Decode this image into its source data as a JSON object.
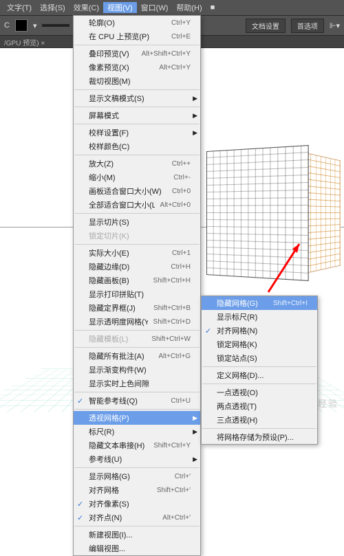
{
  "menubar": {
    "items": [
      "文字(T)",
      "选择(S)",
      "效果(C)",
      "视图(V)",
      "窗口(W)",
      "帮助(H)",
      "■"
    ]
  },
  "toolbar": {
    "doc_label": "文档设置",
    "pref_label": "首选项"
  },
  "subbar": {
    "text": "/GPU 预览)  ×"
  },
  "menu": {
    "g1": [
      {
        "l": "轮廓(O)",
        "s": "Ctrl+Y"
      },
      {
        "l": "在 CPU 上预览(P)",
        "s": "Ctrl+E"
      }
    ],
    "g2": [
      {
        "l": "叠印预览(V)",
        "s": "Alt+Shift+Ctrl+Y"
      },
      {
        "l": "像素预览(X)",
        "s": "Alt+Ctrl+Y"
      },
      {
        "l": "裁切视图(M)"
      }
    ],
    "g3": [
      {
        "l": "显示文稿模式(S)",
        "sub": true
      }
    ],
    "g4": [
      {
        "l": "屏幕模式",
        "sub": true
      }
    ],
    "g5": [
      {
        "l": "校样设置(F)",
        "sub": true
      },
      {
        "l": "校样颜色(C)"
      }
    ],
    "g6": [
      {
        "l": "放大(Z)",
        "s": "Ctrl++"
      },
      {
        "l": "缩小(M)",
        "s": "Ctrl+-"
      },
      {
        "l": "画板适合窗口大小(W)",
        "s": "Ctrl+0"
      },
      {
        "l": "全部适合窗口大小(L)",
        "s": "Alt+Ctrl+0"
      }
    ],
    "g7": [
      {
        "l": "显示切片(S)"
      },
      {
        "l": "锁定切片(K)",
        "dis": true
      }
    ],
    "g8": [
      {
        "l": "实际大小(E)",
        "s": "Ctrl+1"
      },
      {
        "l": "隐藏边缘(D)",
        "s": "Ctrl+H"
      },
      {
        "l": "隐藏画板(B)",
        "s": "Shift+Ctrl+H"
      },
      {
        "l": "显示打印拼贴(T)"
      },
      {
        "l": "隐藏定界框(J)",
        "s": "Shift+Ctrl+B"
      },
      {
        "l": "显示透明度网格(Y)",
        "s": "Shift+Ctrl+D"
      }
    ],
    "g9": [
      {
        "l": "隐藏模板(L)",
        "s": "Shift+Ctrl+W",
        "dis": true
      }
    ],
    "g10": [
      {
        "l": "隐藏所有批注(A)",
        "s": "Alt+Ctrl+G"
      },
      {
        "l": "显示渐变构件(W)"
      },
      {
        "l": "显示实时上色间隙"
      }
    ],
    "g11": [
      {
        "l": "智能参考线(Q)",
        "s": "Ctrl+U",
        "chk": true
      }
    ],
    "g12": [
      {
        "l": "透视网格(P)",
        "sub": true,
        "hl": true
      },
      {
        "l": "标尺(R)",
        "sub": true
      },
      {
        "l": "隐藏文本串接(H)",
        "s": "Shift+Ctrl+Y"
      },
      {
        "l": "参考线(U)",
        "sub": true
      }
    ],
    "g13": [
      {
        "l": "显示网格(G)",
        "s": "Ctrl+'"
      },
      {
        "l": "对齐网格",
        "s": "Shift+Ctrl+'"
      },
      {
        "l": "对齐像素(S)",
        "chk": true
      },
      {
        "l": "对齐点(N)",
        "s": "Alt+Ctrl+'",
        "chk": true
      }
    ],
    "g14": [
      {
        "l": "新建视图(I)..."
      },
      {
        "l": "编辑视图..."
      }
    ]
  },
  "submenu": {
    "items": [
      {
        "l": "隐藏网格(G)",
        "s": "Shift+Ctrl+I",
        "hl": true
      },
      {
        "l": "显示标尺(R)"
      },
      {
        "l": "对齐网格(N)",
        "chk": true
      },
      {
        "l": "锁定网格(K)"
      },
      {
        "l": "锁定站点(S)"
      },
      {
        "sep": true
      },
      {
        "l": "定义网格(D)..."
      },
      {
        "sep": true
      },
      {
        "l": "一点透视(O)"
      },
      {
        "l": "两点透视(T)"
      },
      {
        "l": "三点透视(H)"
      },
      {
        "sep": true
      },
      {
        "l": "将网格存储为预设(P)..."
      }
    ]
  },
  "watermark": "百度经验"
}
